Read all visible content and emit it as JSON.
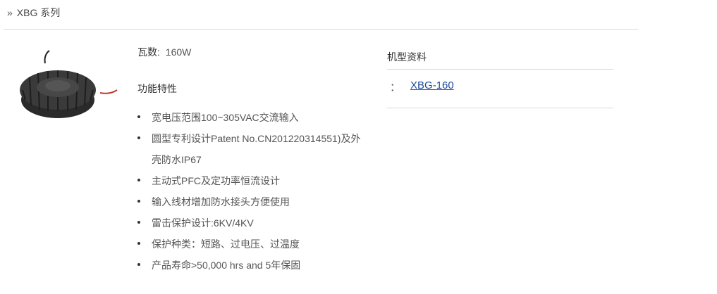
{
  "breadcrumb": {
    "arrow": "»",
    "label": "XBG 系列"
  },
  "product": {
    "wattage_label": "瓦数:",
    "wattage_value": "160W",
    "features_title": "功能特性",
    "features": [
      "宽电压范围100~305VAC交流输入",
      "圆型专利设计Patent No.CN201220314551)及外壳防水IP67",
      "主动式PFC及定功率恒流设计",
      "输入线材增加防水接头方便使用",
      "雷击保护设计:6KV/4KV",
      "保护种类：短路、过电压、过温度",
      "产品寿命>50,000 hrs and 5年保固"
    ]
  },
  "model_info": {
    "title": "机型资料",
    "separator": "：",
    "link_label": "XBG-160"
  }
}
